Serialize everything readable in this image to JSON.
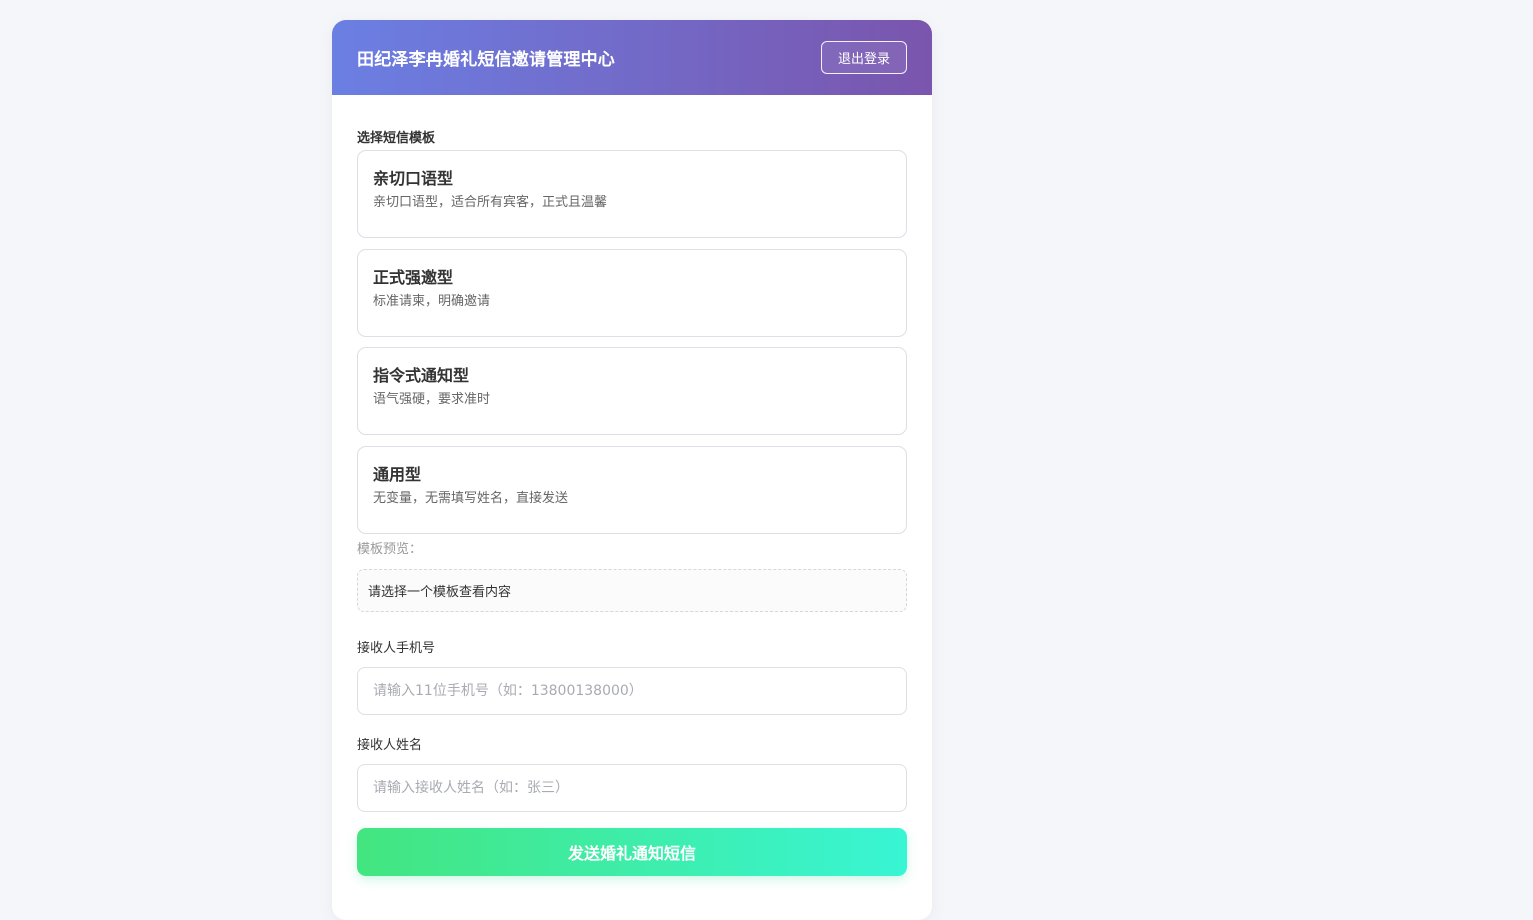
{
  "header": {
    "title": "田纪泽李冉婚礼短信邀请管理中心",
    "logout_label": "退出登录"
  },
  "templates": {
    "section_label": "选择短信模板",
    "items": [
      {
        "name": "亲切口语型",
        "description": "亲切口语型，适合所有宾客，正式且温馨"
      },
      {
        "name": "正式强邀型",
        "description": "标准请柬，明确邀请"
      },
      {
        "name": "指令式通知型",
        "description": "语气强硬，要求准时"
      },
      {
        "name": "通用型",
        "description": "无变量，无需填写姓名，直接发送"
      }
    ]
  },
  "preview": {
    "label": "模板预览：",
    "content": "请选择一个模板查看内容"
  },
  "form": {
    "phone_label": "接收人手机号",
    "phone_placeholder": "请输入11位手机号（如：13800138000）",
    "phone_value": "",
    "name_label": "接收人姓名",
    "name_placeholder": "请输入接收人姓名（如：张三）",
    "name_value": "",
    "send_label": "发送婚礼通知短信"
  },
  "colors": {
    "header_gradient_start": "#6b7fe3",
    "header_gradient_end": "#7a55ad",
    "button_gradient_start": "#43e57f",
    "button_gradient_end": "#38f5d4",
    "page_background": "#f5f6fa"
  }
}
